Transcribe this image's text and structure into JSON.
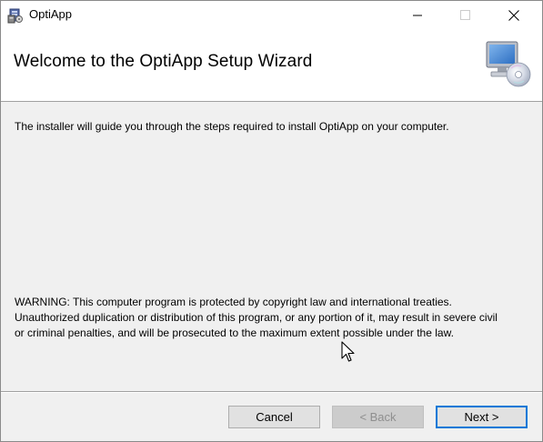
{
  "window": {
    "title": "OptiApp",
    "minimize_icon": "minimize-icon",
    "maximize_icon": "maximize-icon",
    "close_icon": "close-icon"
  },
  "header": {
    "title": "Welcome to the OptiApp Setup Wizard",
    "icon": "computer-cd-icon"
  },
  "main": {
    "intro": "The installer will guide you through the steps required to install OptiApp on your computer.",
    "warning_lines": [
      "WARNING: This computer program is protected by copyright law and international treaties.",
      "Unauthorized duplication or distribution of this program, or any portion of it, may result in severe civil",
      "or criminal penalties, and will be prosecuted to the maximum extent possible under the law."
    ]
  },
  "footer": {
    "cancel_label": "Cancel",
    "back_label": "< Back",
    "back_enabled": false,
    "next_label": "Next >",
    "default_button": "next"
  },
  "colors": {
    "focus_border": "#0078d7",
    "window_bg": "#f0f0f0",
    "header_bg": "#ffffff"
  }
}
